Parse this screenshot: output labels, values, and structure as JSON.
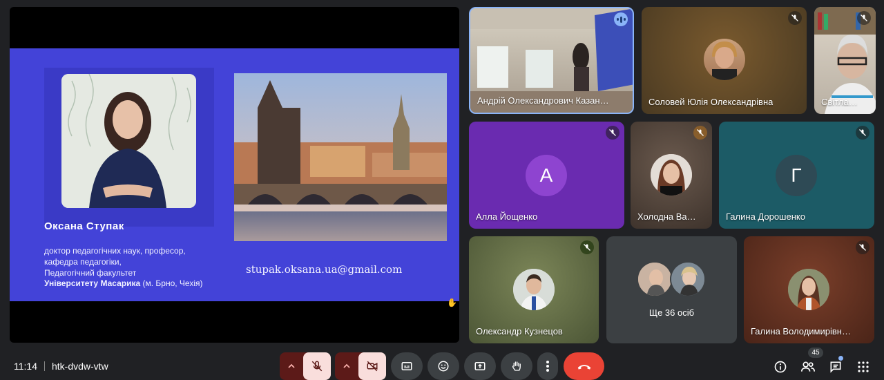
{
  "slide": {
    "name": "Оксана Ступак",
    "line1": "доктор педагогічних наук,  професор,",
    "line2": "кафедра педагогіки,",
    "line3": "Педагогічний факультет",
    "line4_bold": "Університету Масарика",
    "line4_rest": " (м. Брно, Чехія)",
    "email": "stupak.oksana.ua@gmail.com"
  },
  "participants": [
    {
      "name": "Андрій Олександрович Казан…",
      "state": "speaking"
    },
    {
      "name": "Соловей Юлія Олександрівна",
      "state": "muted"
    },
    {
      "name": "Світла…",
      "state": "muted"
    },
    {
      "name": "Алла Йощенко",
      "initial": "А",
      "state": "muted"
    },
    {
      "name": "Холодна Ва…",
      "state": "muted"
    },
    {
      "name": "Галина Дорошенко",
      "initial": "Г",
      "state": "muted"
    },
    {
      "name": "Олександр Кузнецов",
      "state": "muted"
    },
    {
      "name": "Галина Володимирівн…",
      "state": "muted"
    }
  ],
  "others": {
    "label": "Ще 36 осіб"
  },
  "bottom_bar": {
    "time": "11:14",
    "meeting_code": "htk-dvdw-vtw",
    "people_count": "45"
  },
  "colors": {
    "slide_bg": "#4343d8",
    "hangup": "#ea4335",
    "muted_control": "#f9dedc",
    "speaking_accent": "#8ab4f8"
  },
  "icons": [
    "mic-off-icon",
    "camera-off-icon",
    "captions-icon",
    "emoji-icon",
    "present-icon",
    "raise-hand-icon",
    "more-options-icon",
    "hang-up-icon",
    "info-icon",
    "people-icon",
    "chat-icon",
    "apps-icon",
    "chevron-up-icon"
  ]
}
